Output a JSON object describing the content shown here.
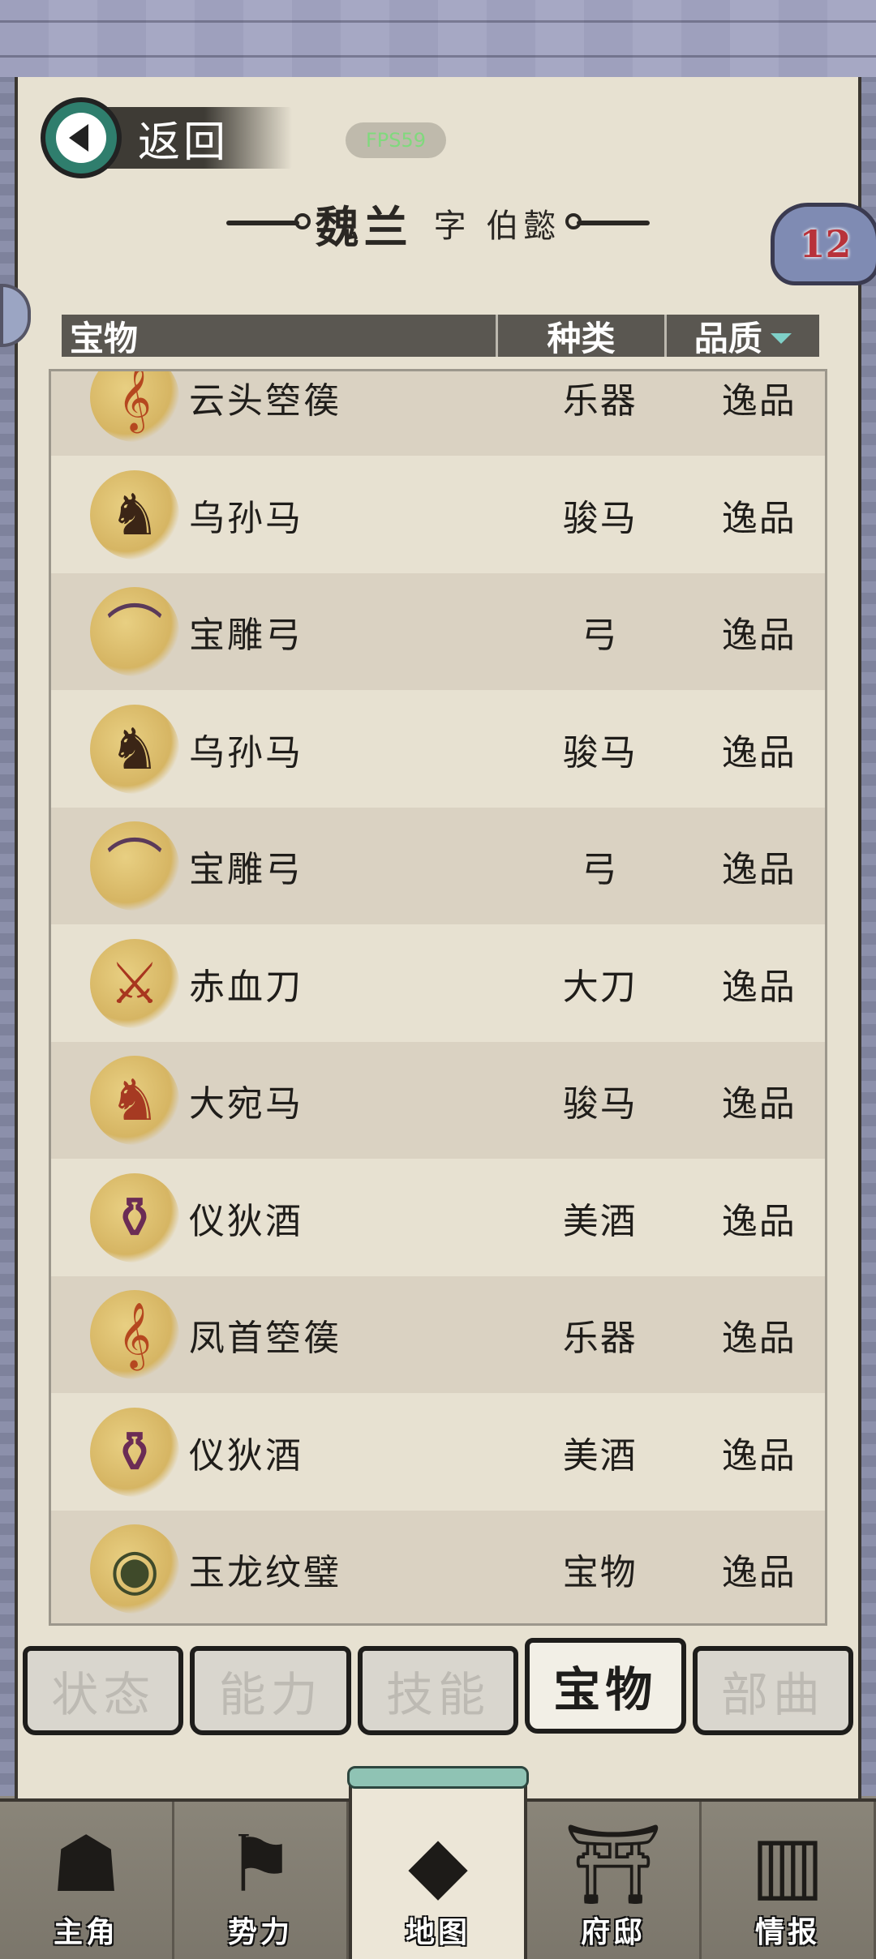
{
  "header": {
    "back_label": "返回",
    "fps_label": "FPS59",
    "character_name": "魏兰",
    "courtesy_name": "字 伯懿",
    "badge_count": "12"
  },
  "table": {
    "columns": [
      "宝物",
      "种类",
      "品质"
    ],
    "sort_column": "品质",
    "rows": [
      {
        "name": "云头箜篌",
        "type": "乐器",
        "quality": "逸品",
        "icon": "harp-icon"
      },
      {
        "name": "乌孙马",
        "type": "骏马",
        "quality": "逸品",
        "icon": "horse-icon"
      },
      {
        "name": "宝雕弓",
        "type": "弓",
        "quality": "逸品",
        "icon": "bow-icon"
      },
      {
        "name": "乌孙马",
        "type": "骏马",
        "quality": "逸品",
        "icon": "horse-icon"
      },
      {
        "name": "宝雕弓",
        "type": "弓",
        "quality": "逸品",
        "icon": "bow-icon"
      },
      {
        "name": "赤血刀",
        "type": "大刀",
        "quality": "逸品",
        "icon": "blade-icon"
      },
      {
        "name": "大宛马",
        "type": "骏马",
        "quality": "逸品",
        "icon": "red-horse-icon"
      },
      {
        "name": "仪狄酒",
        "type": "美酒",
        "quality": "逸品",
        "icon": "wine-jar-icon"
      },
      {
        "name": "凤首箜篌",
        "type": "乐器",
        "quality": "逸品",
        "icon": "harp-icon"
      },
      {
        "name": "仪狄酒",
        "type": "美酒",
        "quality": "逸品",
        "icon": "wine-jar-icon"
      },
      {
        "name": "玉龙纹璧",
        "type": "宝物",
        "quality": "逸品",
        "icon": "jade-disc-icon"
      }
    ]
  },
  "tabs": [
    {
      "label": "状态",
      "active": false
    },
    {
      "label": "能力",
      "active": false
    },
    {
      "label": "技能",
      "active": false
    },
    {
      "label": "宝物",
      "active": true
    },
    {
      "label": "部曲",
      "active": false
    }
  ],
  "bottom_nav": [
    {
      "label": "主角",
      "icon": "hero-icon",
      "active": false
    },
    {
      "label": "势力",
      "icon": "flag-icon",
      "active": false
    },
    {
      "label": "地图",
      "icon": "map-icon",
      "active": true
    },
    {
      "label": "府邸",
      "icon": "mansion-icon",
      "active": false
    },
    {
      "label": "情报",
      "icon": "scroll-icon",
      "active": false
    }
  ]
}
